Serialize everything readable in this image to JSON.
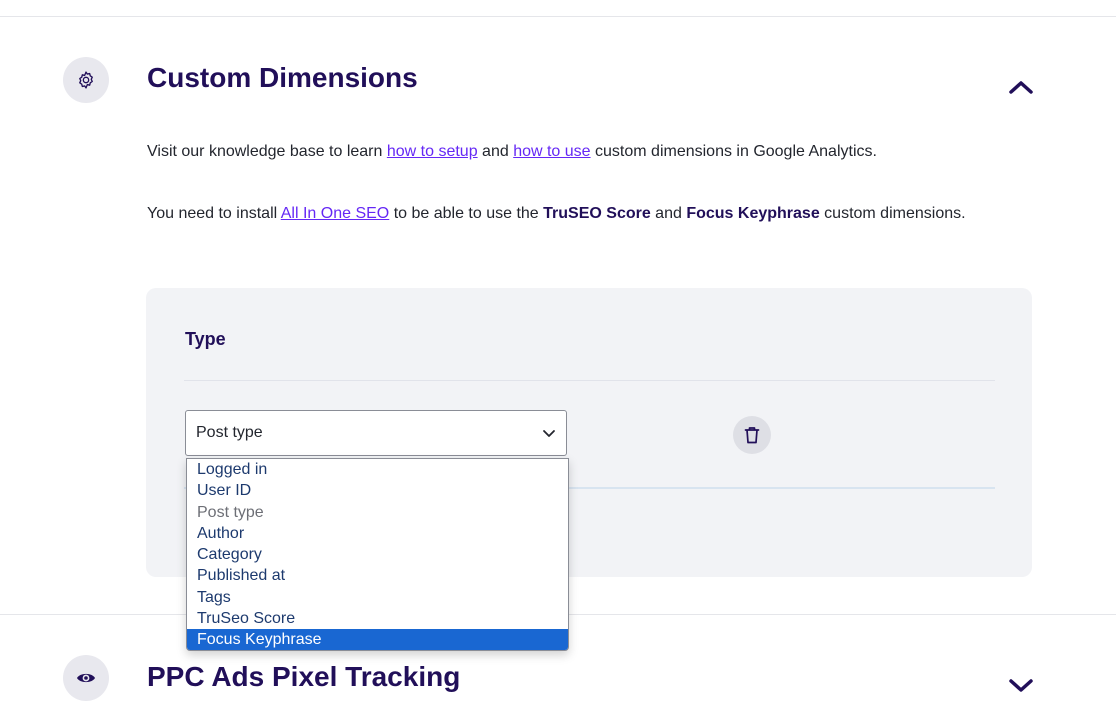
{
  "custom_dimensions": {
    "title": "Custom Dimensions",
    "intro_prefix": "Visit our knowledge base to learn ",
    "link_setup": "how to setup",
    "intro_and": " and ",
    "link_use": "how to use",
    "intro_suffix": " custom dimensions in Google Analytics.",
    "install_prefix": "You need to install ",
    "install_link": "All In One SEO",
    "install_mid": " to be able to use the ",
    "bold_truseo": "TruSEO Score",
    "install_and": " and ",
    "bold_focus": "Focus Keyphrase",
    "install_suffix": " custom dimensions.",
    "type_label": "Type",
    "select_value": "Post type",
    "options": [
      {
        "label": "Logged in",
        "state": "normal"
      },
      {
        "label": "User ID",
        "state": "normal"
      },
      {
        "label": "Post type",
        "state": "disabled"
      },
      {
        "label": "Author",
        "state": "normal"
      },
      {
        "label": "Category",
        "state": "normal"
      },
      {
        "label": "Published at",
        "state": "normal"
      },
      {
        "label": "Tags",
        "state": "normal"
      },
      {
        "label": "TruSeo Score",
        "state": "normal"
      },
      {
        "label": "Focus Keyphrase",
        "state": "selected"
      }
    ]
  },
  "ppc": {
    "title": "PPC Ads Pixel Tracking"
  },
  "colors": {
    "heading": "#210f59",
    "link": "#6528f5",
    "option_highlight": "#1967d2"
  },
  "icons": {
    "custom_dimensions": "gear-icon",
    "ppc": "eye-icon",
    "collapse": "chevron-up-icon",
    "expand": "chevron-down-icon",
    "delete": "trash-icon"
  }
}
